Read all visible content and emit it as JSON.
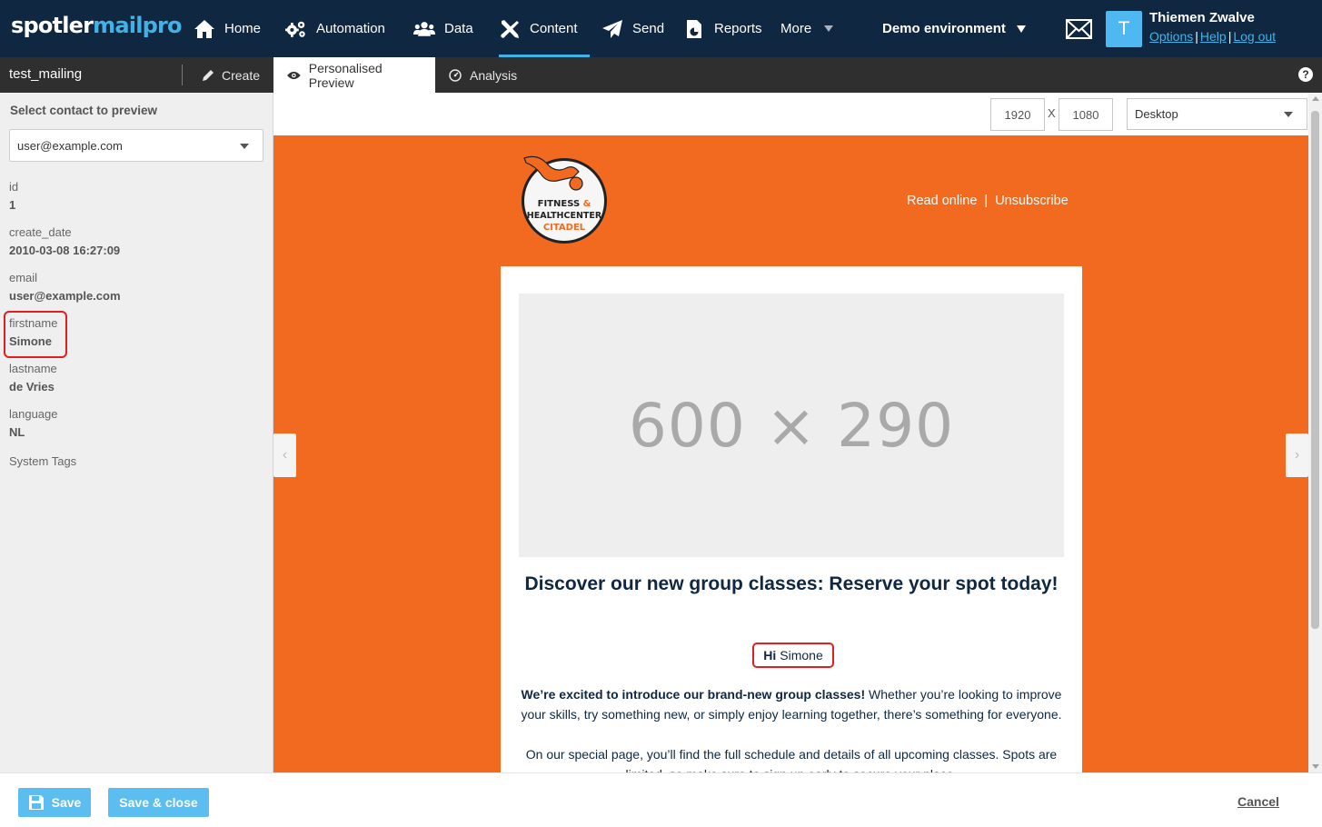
{
  "brand": {
    "part1": "spotler",
    "part2": "mailpro"
  },
  "nav": {
    "items": [
      {
        "label": "Home",
        "icon": "home-icon"
      },
      {
        "label": "Automation",
        "icon": "gears-icon"
      },
      {
        "label": "Data",
        "icon": "users-icon"
      },
      {
        "label": "Content",
        "icon": "tools-icon",
        "active": true
      },
      {
        "label": "Send",
        "icon": "paper-plane-icon"
      },
      {
        "label": "Reports",
        "icon": "report-icon"
      },
      {
        "label": "More",
        "icon": "caret-down-icon"
      }
    ],
    "environment": "Demo environment"
  },
  "user": {
    "initial": "T",
    "name": "Thiemen Zwalve",
    "links": [
      "Options",
      "Help",
      "Log out"
    ],
    "separator": "|"
  },
  "subbar": {
    "mailing_name": "test_mailing",
    "create_label": "Create",
    "tabs": [
      {
        "label": "Personalised Preview",
        "active": true
      },
      {
        "label": "Analysis"
      }
    ],
    "help_glyph": "?"
  },
  "sidebar": {
    "title": "Select contact to preview",
    "selected_contact": "user@example.com",
    "fields": [
      {
        "key": "id",
        "value": "1"
      },
      {
        "key": "create_date",
        "value": "2010-03-08 16:27:09"
      },
      {
        "key": "email",
        "value": "user@example.com"
      },
      {
        "key": "firstname",
        "value": "Simone",
        "highlighted": true
      },
      {
        "key": "lastname",
        "value": "de Vries"
      },
      {
        "key": "language",
        "value": "NL"
      }
    ],
    "system_tags_label": "System Tags"
  },
  "preview": {
    "width": "1920",
    "height": "1080",
    "separator": "X",
    "device": "Desktop",
    "nav_prev": "‹",
    "nav_next": "›"
  },
  "email": {
    "bg_color": "#f26a1f",
    "logo_text": [
      "FITNESS",
      "&",
      "HEALTHCENTER",
      "CITADEL"
    ],
    "read_online": "Read online",
    "link_separator": "|",
    "unsubscribe": "Unsubscribe",
    "image_placeholder": "600 × 290",
    "heading": "Discover our new group classes: Reserve your spot today!",
    "greeting_word": "Hi",
    "greeting_name": "Simone",
    "para1_bold": "We’re excited to introduce our brand-new group classes!",
    "para1_rest": " Whether you’re looking to improve your skills, try something new, or simply enjoy learning together, there’s something for everyone.",
    "para2": "On our special page, you’ll find the full schedule and details of all upcoming classes. Spots are limited, so make sure to sign up early to secure your place."
  },
  "footer": {
    "save": "Save",
    "save_close": "Save & close",
    "cancel": "Cancel"
  },
  "colors": {
    "nav_bg": "#0f2740",
    "accent": "#3fb3e8",
    "button": "#5cbdf0",
    "highlight": "#e02020"
  }
}
